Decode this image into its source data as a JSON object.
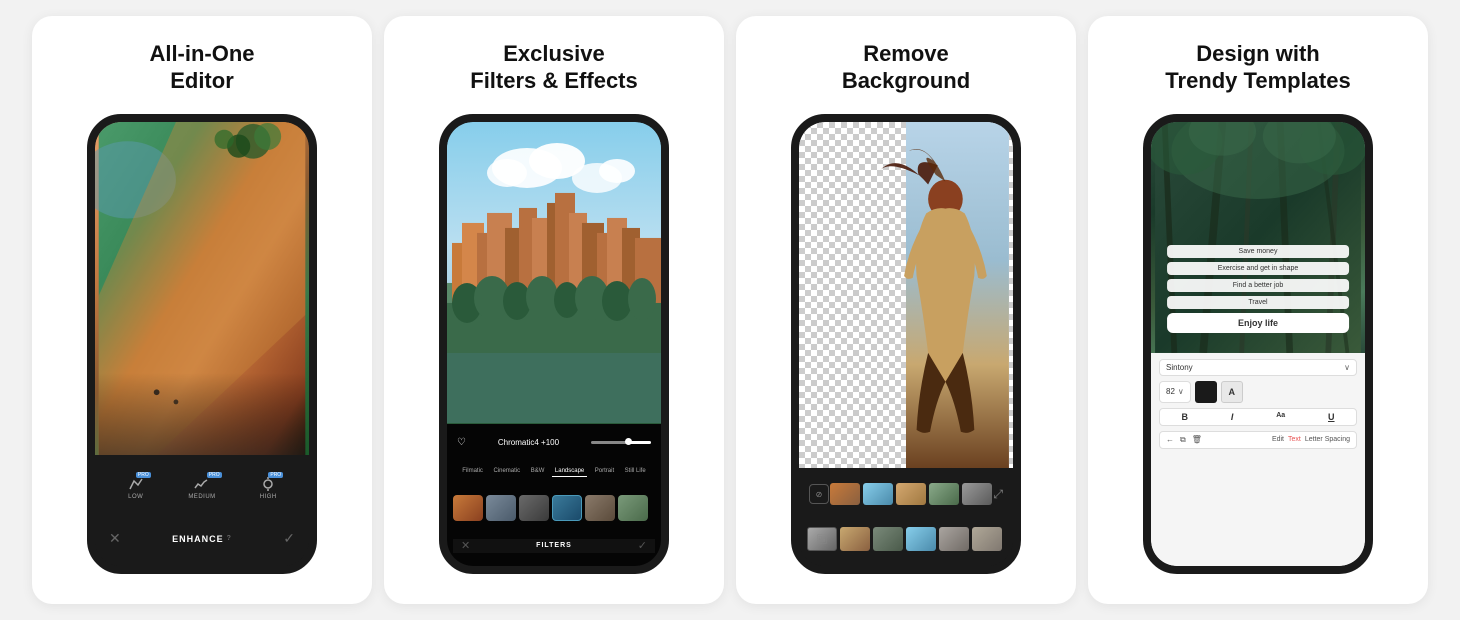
{
  "cards": [
    {
      "id": "card1",
      "title": "All-in-One\nEditor",
      "enhance_items": [
        {
          "label": "LOW",
          "icon": "✦"
        },
        {
          "label": "MEDIUM",
          "icon": "≋"
        },
        {
          "label": "HIGH",
          "icon": "⊕"
        }
      ],
      "bottom_left": "✕",
      "enhance_label": "ENHANCE",
      "bottom_right": "✓"
    },
    {
      "id": "card2",
      "title": "Exclusive\nFilters & Effects",
      "filter_name": "Chromatic4  +100",
      "filter_tabs": [
        "Filmatic",
        "Cinematic",
        "B&W",
        "Landscape",
        "Portrait",
        "Still Life"
      ],
      "active_tab": "Landscape",
      "bottom_left": "✕",
      "filters_label": "FILTERS",
      "bottom_right": "✓"
    },
    {
      "id": "card3",
      "title": "Remove\nBackground"
    },
    {
      "id": "card4",
      "title": "Design with\nTrendy Templates",
      "template_items": [
        "Save money",
        "Exercise and get in shape",
        "Find a better job",
        "Travel"
      ],
      "highlight_item": "Enjoy life",
      "font_name": "Sintony",
      "font_size": "82",
      "format_buttons": [
        "B",
        "I",
        "Aa",
        "U"
      ],
      "edit_icons": [
        "←",
        "⧉",
        "🗑"
      ],
      "edit_buttons": [
        "Edit",
        "Text",
        "Letter Spacing"
      ]
    }
  ]
}
